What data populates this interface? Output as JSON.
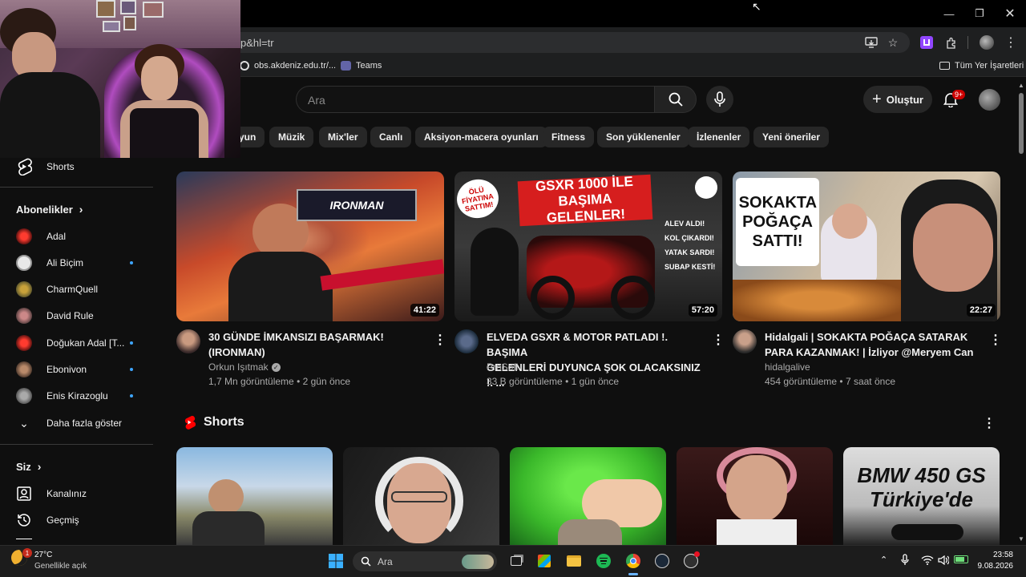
{
  "browser": {
    "url": "p&hl=tr",
    "window_controls": [
      "minimize-icon",
      "maximize-icon",
      "close-icon"
    ],
    "bookmarks": [
      {
        "label": "obs.akdeniz.edu.tr/...",
        "icon": "site-icon"
      },
      {
        "label": "Teams",
        "icon": "teams-icon"
      }
    ],
    "all_bookmarks_label": "Tüm Yer İşaretleri"
  },
  "header": {
    "search_placeholder": "Ara",
    "create_label": "Oluştur",
    "notification_count": "9+"
  },
  "chips": [
    "yun",
    "Müzik",
    "Mix'ler",
    "Canlı",
    "Aksiyon-macera oyunları",
    "Fitness",
    "Son yüklenenler",
    "İzlenenler",
    "Yeni öneriler"
  ],
  "sidebar": {
    "shorts_label": "Shorts",
    "subscriptions_heading": "Abonelikler",
    "subscriptions": [
      {
        "label": "Adal",
        "dot": false
      },
      {
        "label": "Ali Biçim",
        "dot": true
      },
      {
        "label": "CharmQuell",
        "dot": false
      },
      {
        "label": "David Rule",
        "dot": false
      },
      {
        "label": "Doğukan Adal [T...",
        "dot": true
      },
      {
        "label": "Ebonivon",
        "dot": true
      },
      {
        "label": "Enis Kirazoglu",
        "dot": true
      }
    ],
    "show_more_label": "Daha fazla göster",
    "you_heading": "Siz",
    "you_items": [
      {
        "label": "Kanalınız",
        "icon": "account-box-icon"
      },
      {
        "label": "Geçmiş",
        "icon": "history-icon"
      }
    ]
  },
  "videos": [
    {
      "title_line1": "30 GÜNDE İMKANSIZI BAŞARMAK!",
      "title_line2": "(IRONMAN)",
      "channel": "Orkun Işıtmak",
      "verified": true,
      "views": "1,7 Mn görüntüleme",
      "age": "2 gün önce",
      "duration": "41:22",
      "thumb_text": "IRONMAN"
    },
    {
      "title_line1": "ELVEDA GSXR & MOTOR PATLADI !. BAŞIMA",
      "title_line2": "GELENLERİ DUYUNCA ŞOK OLACAKSINIZ !. ...",
      "channel": "ProSofi",
      "verified": false,
      "views": "33 B görüntüleme",
      "age": "1 gün önce",
      "duration": "57:20",
      "thumb_text": "GSXR 1000 İLE BAŞIMA GELENLER!",
      "thumb_badge": "ÖLÜ FİYATINA SATTIM!",
      "thumb_list": [
        "ALEV ALDI!",
        "KOL ÇIKARDI!",
        "YATAK SARDI!",
        "SUBAP KESTİ!"
      ]
    },
    {
      "title_line1": "Hidalgali | SOKAKTA POĞAÇA SATARAK",
      "title_line2": "PARA KAZANMAK! | İzliyor @Meryem Can",
      "channel": "hidalgalive",
      "verified": false,
      "views": "454 görüntüleme",
      "age": "7 saat önce",
      "duration": "22:27",
      "thumb_text": "SOKAKTA POĞAÇA SATTI!"
    }
  ],
  "shorts_section": {
    "title": "Shorts",
    "last_short_text": "BMW 450 GS Türkiye'de"
  },
  "taskbar": {
    "weather_temp": "27°C",
    "weather_desc": "Genellikle açık",
    "weather_badge": "1",
    "search_label": "Ara",
    "time": "23:58",
    "date": "9.08.2026"
  },
  "colors": {
    "bg": "#0f0f0f",
    "chip": "#272727",
    "accent_red": "#ff0000",
    "link_dot": "#3ea6ff"
  }
}
